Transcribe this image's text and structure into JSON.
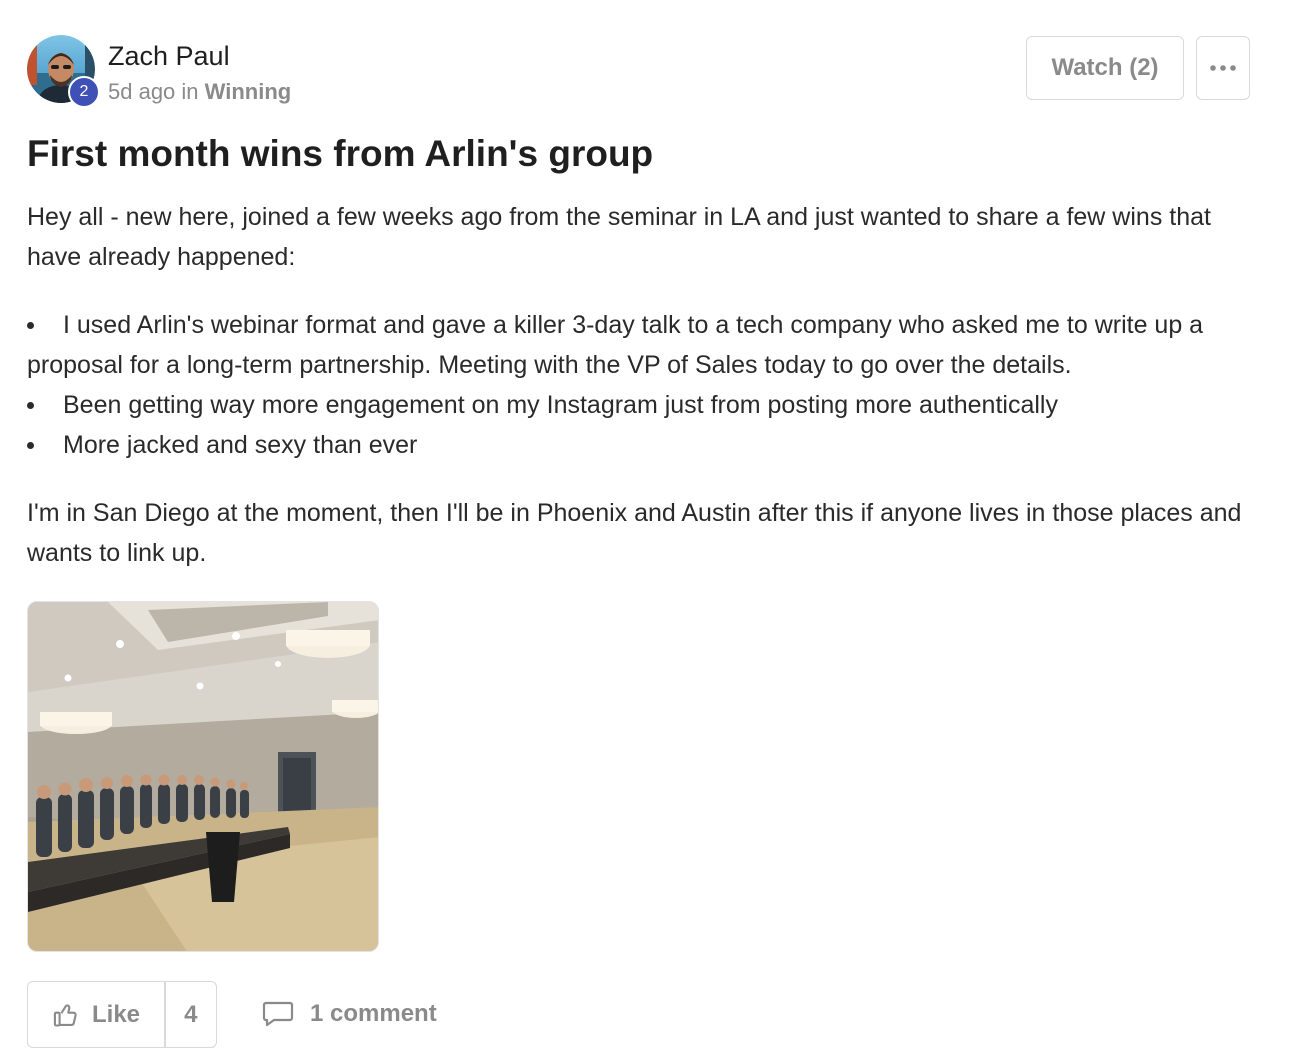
{
  "author": {
    "name": "Zach Paul",
    "level": "2",
    "time_ago": "5d ago",
    "in_word": "in",
    "category": "Winning"
  },
  "actions": {
    "watch_label": "Watch (2)",
    "more_icon": "ellipsis-icon"
  },
  "post": {
    "title": "First month wins from Arlin's group",
    "intro": "Hey all - new here, joined a few weeks ago from the seminar in LA and just wanted to share a few wins that have already happened:",
    "bullets": [
      "I used Arlin's webinar format and gave a killer 3-day talk to a tech company who asked me to write up a proposal for a long-term partnership. Meeting with the VP of Sales today to go over the details.",
      "Been getting way more engagement on my Instagram just from posting more authentically",
      "More jacked and sexy than ever"
    ],
    "closing": "I'm in San Diego at the moment, then I'll be in Phoenix and Austin after this if anyone lives in those places and wants to link up."
  },
  "footer": {
    "like_label": "Like",
    "like_count": "4",
    "comment_label": "1 comment",
    "like_icon": "thumbs-up-icon",
    "comment_icon": "speech-bubble-icon"
  },
  "colors": {
    "badge": "#3f51b5",
    "muted": "#8a8a8a",
    "border": "#d9d9d9"
  }
}
